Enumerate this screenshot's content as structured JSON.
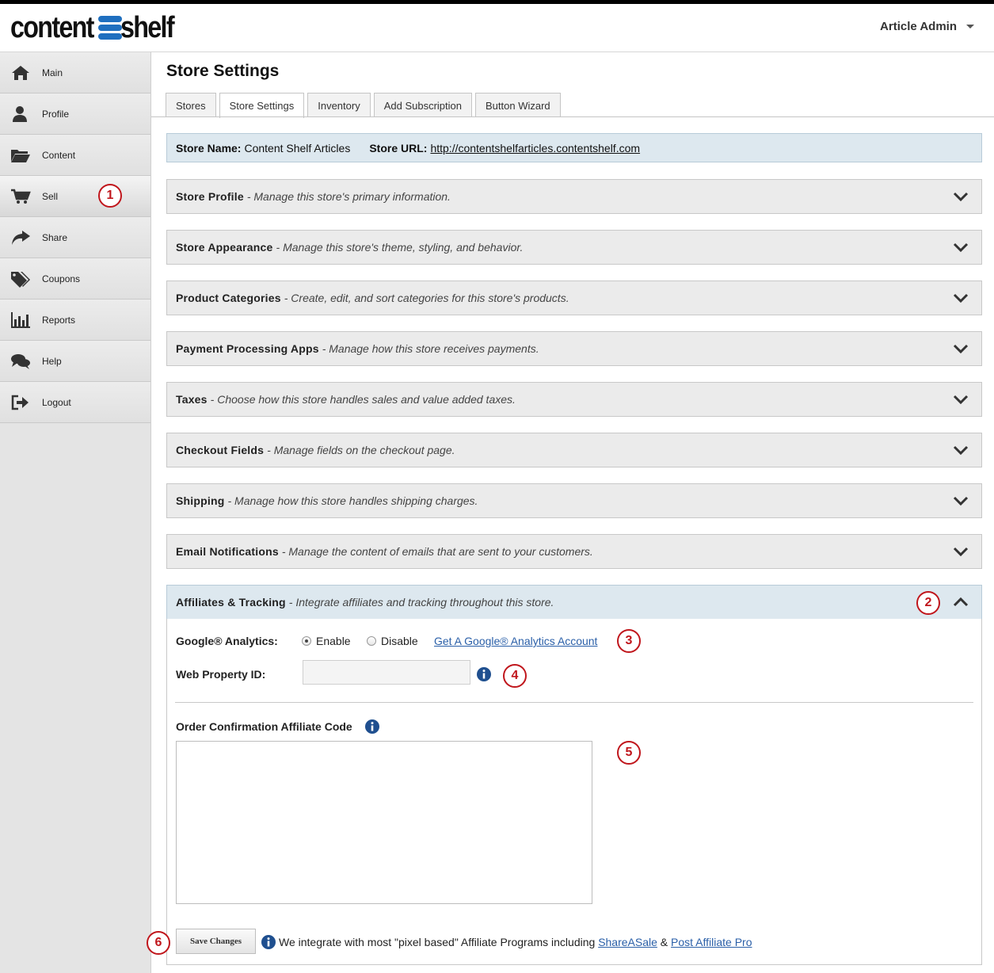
{
  "header": {
    "logo_left": "content",
    "logo_right": "shelf",
    "user_label": "Article Admin"
  },
  "sidebar": {
    "items": [
      {
        "label": "Main",
        "icon": "home-icon"
      },
      {
        "label": "Profile",
        "icon": "person-icon"
      },
      {
        "label": "Content",
        "icon": "folder-icon"
      },
      {
        "label": "Sell",
        "icon": "cart-icon"
      },
      {
        "label": "Share",
        "icon": "share-arrow-icon"
      },
      {
        "label": "Coupons",
        "icon": "tags-icon"
      },
      {
        "label": "Reports",
        "icon": "bar-chart-icon"
      },
      {
        "label": "Help",
        "icon": "chat-bubbles-icon"
      },
      {
        "label": "Logout",
        "icon": "logout-icon"
      }
    ]
  },
  "callouts": [
    "1",
    "2",
    "3",
    "4",
    "5",
    "6"
  ],
  "page": {
    "title": "Store Settings",
    "tabs": [
      "Stores",
      "Store Settings",
      "Inventory",
      "Add Subscription",
      "Button Wizard"
    ],
    "active_tab": "Store Settings"
  },
  "store_info": {
    "name_label": "Store Name:",
    "name_value": "Content Shelf Articles",
    "url_label": "Store URL:",
    "url_value": "http://contentshelfarticles.contentshelf.com"
  },
  "panels": [
    {
      "title": "Store Profile",
      "desc": "- Manage this store's primary information."
    },
    {
      "title": "Store Appearance",
      "desc": "- Manage this store's theme, styling, and behavior."
    },
    {
      "title": "Product Categories",
      "desc": "- Create, edit, and sort categories for this store's products."
    },
    {
      "title": "Payment Processing Apps",
      "desc": "- Manage how this store receives payments."
    },
    {
      "title": "Taxes",
      "desc": "- Choose how this store handles sales and value added taxes."
    },
    {
      "title": "Checkout Fields",
      "desc": "- Manage fields on the checkout page."
    },
    {
      "title": "Shipping",
      "desc": "- Manage how this store handles shipping charges."
    },
    {
      "title": "Email Notifications",
      "desc": "- Manage the content of emails that are sent to your customers."
    },
    {
      "title": "Affiliates & Tracking",
      "desc": "- Integrate affiliates and tracking throughout this store."
    }
  ],
  "affiliates": {
    "ga_label": "Google® Analytics:",
    "enable_label": "Enable",
    "disable_label": "Disable",
    "selected": "Enable",
    "ga_link": "Get A Google® Analytics Account",
    "web_property_label": "Web Property ID:",
    "web_property_value": "",
    "order_code_label": "Order Confirmation Affiliate Code",
    "order_code_value": "",
    "save_label": "Save Changes",
    "footnote_text": "We integrate with most \"pixel based\" Affiliate Programs including",
    "footnote_link1": "ShareASale",
    "footnote_amp": "&",
    "footnote_link2": "Post Affiliate Pro"
  },
  "colors": {
    "accent_link": "#2a5fa8",
    "callout_red": "#c0161c",
    "open_panel_bg": "#dde8ef",
    "logo_blue": "#1f6fbf"
  }
}
